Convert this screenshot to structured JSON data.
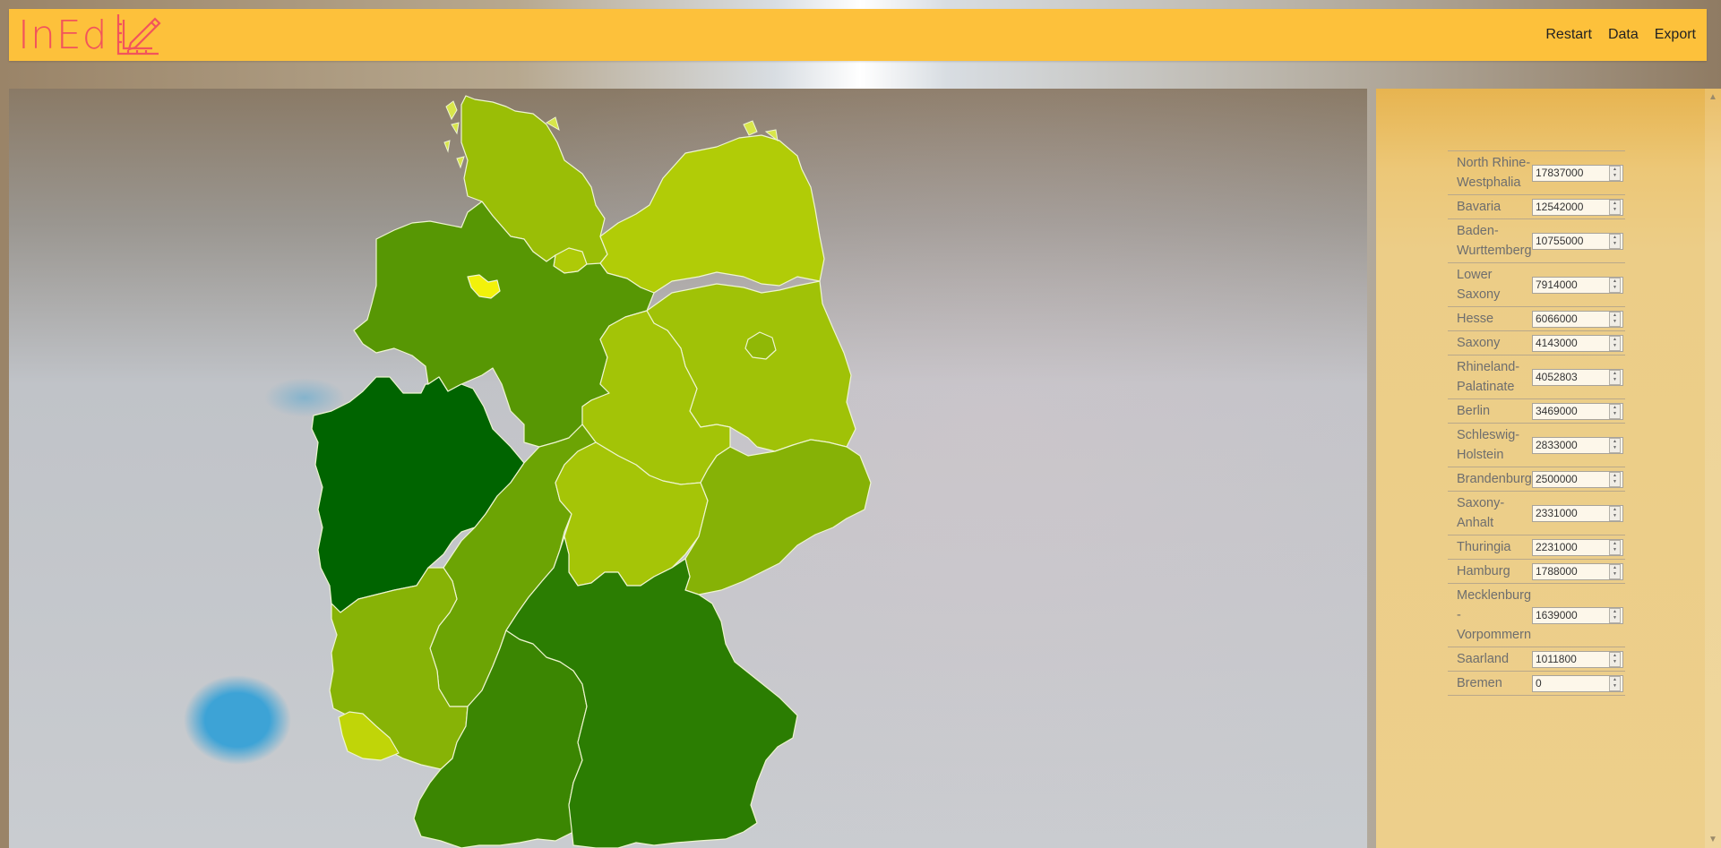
{
  "app": {
    "logo_text": "InEd",
    "logo_icon": "ruler-pencil-icon"
  },
  "nav": {
    "items": [
      "Restart",
      "Data",
      "Export"
    ]
  },
  "colors": {
    "header": "#fdc13b",
    "logo": "#f2545b",
    "scale_low": "#f2f20a",
    "scale_high": "#006400"
  },
  "map": {
    "title": "",
    "region": "Germany",
    "kind": "choropleth"
  },
  "states": [
    {
      "name": "North Rhine-Westphalia",
      "value": "17837000"
    },
    {
      "name": "Bavaria",
      "value": "12542000"
    },
    {
      "name": "Baden-Wurttemberg",
      "value": "10755000"
    },
    {
      "name": "Lower Saxony",
      "value": "7914000"
    },
    {
      "name": "Hesse",
      "value": "6066000"
    },
    {
      "name": "Saxony",
      "value": "4143000"
    },
    {
      "name": "Rhineland-Palatinate",
      "value": "4052803"
    },
    {
      "name": "Berlin",
      "value": "3469000"
    },
    {
      "name": "Schleswig-Holstein",
      "value": "2833000"
    },
    {
      "name": "Brandenburg",
      "value": "2500000"
    },
    {
      "name": "Saxony-Anhalt",
      "value": "2331000"
    },
    {
      "name": "Thuringia",
      "value": "2231000"
    },
    {
      "name": "Hamburg",
      "value": "1788000"
    },
    {
      "name": "Mecklenburg-Vorpommern",
      "value": "1639000"
    },
    {
      "name": "Saarland",
      "value": "1011800"
    },
    {
      "name": "Bremen",
      "value": "0"
    }
  ]
}
